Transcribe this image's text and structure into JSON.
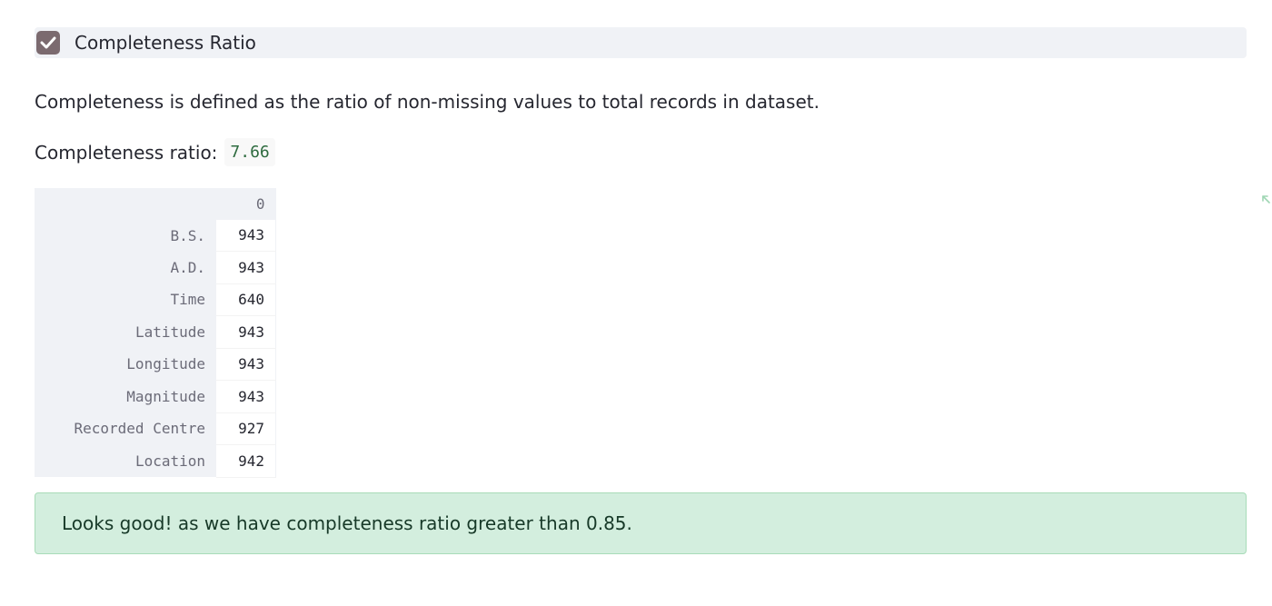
{
  "checkbox": {
    "label": "Completeness Ratio",
    "checked": true,
    "color": "#7b6a6f"
  },
  "description": "Completeness is defined as the ratio of non-missing values to total records in dataset.",
  "ratio": {
    "label": "Completeness ratio:",
    "value": "7.66"
  },
  "table": {
    "column_header": "0",
    "rows": [
      {
        "label": "B.S.",
        "value": "943"
      },
      {
        "label": "A.D.",
        "value": "943"
      },
      {
        "label": "Time",
        "value": "640"
      },
      {
        "label": "Latitude",
        "value": "943"
      },
      {
        "label": "Longitude",
        "value": "943"
      },
      {
        "label": "Magnitude",
        "value": "943"
      },
      {
        "label": "Recorded Centre",
        "value": "927"
      },
      {
        "label": "Location",
        "value": "942"
      }
    ]
  },
  "success_message": "Looks good! as we have completeness ratio greater than 0.85.",
  "icons": {
    "checkbox": "check-icon",
    "expand": "expand-icon"
  },
  "colors": {
    "success_bg": "#d3eede",
    "success_text": "#173928",
    "code_text": "#2e6b3f"
  }
}
